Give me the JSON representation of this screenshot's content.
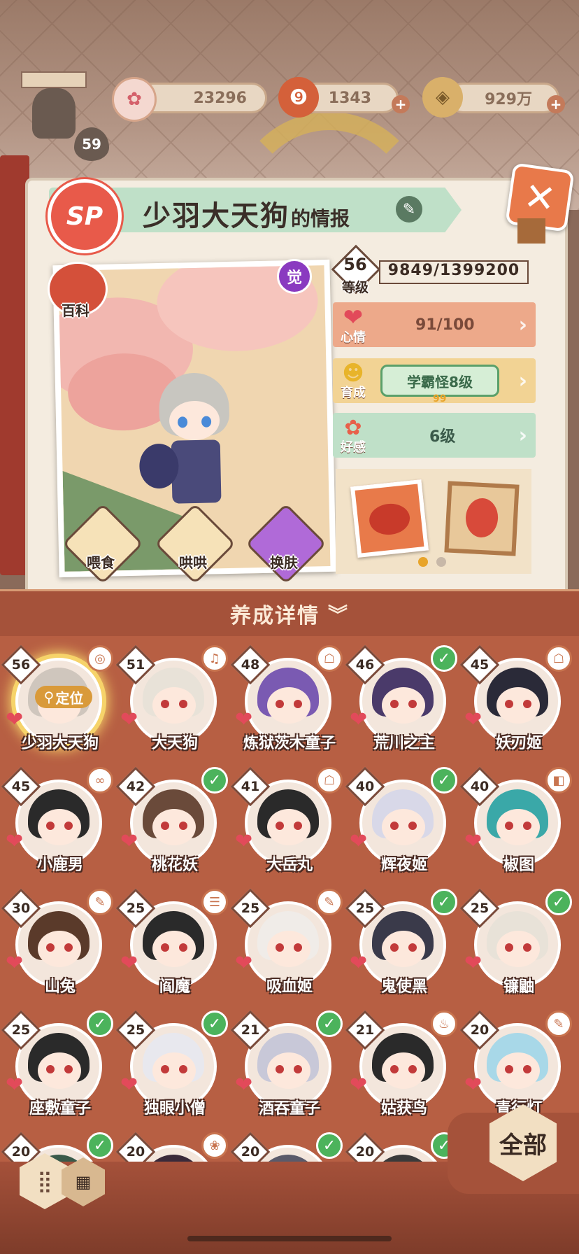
{
  "currency": {
    "player_level": "59",
    "items": [
      {
        "icon": "plum-blossom-icon",
        "value": "23296"
      },
      {
        "icon": "magatama-icon",
        "value": "1343"
      },
      {
        "icon": "coin-icon",
        "value": "929万"
      }
    ]
  },
  "header": {
    "title": "少羽大天狗",
    "title_suffix": "的情报",
    "rarity": "SP",
    "awaken": "觉"
  },
  "portrait": {
    "encyclopedia": "百科",
    "actions": [
      {
        "label": "喂食",
        "icon": "ramen-icon"
      },
      {
        "label": "哄哄",
        "icon": "milk-icon"
      },
      {
        "label": "换肤",
        "icon": "skin-icon"
      }
    ]
  },
  "stats": {
    "level_label": "等级",
    "level": "56",
    "exp": "9849/1399200",
    "mood_label": "心情",
    "mood": "91/100",
    "growth_label": "育成",
    "growth": "学霸怪8级",
    "growth_badge": "99",
    "favor_label": "好感",
    "favor": "6级"
  },
  "roster": {
    "header": "养成详情",
    "locate": "定位",
    "items": [
      {
        "name": "少羽大天狗",
        "level": "56",
        "status": "target",
        "color": "#cfc6bd"
      },
      {
        "name": "大天狗",
        "level": "51",
        "status": "bell",
        "color": "#e8e2d8"
      },
      {
        "name": "炼狱茨木童子",
        "level": "48",
        "status": "scroll",
        "color": "#7a5ab2"
      },
      {
        "name": "荒川之主",
        "level": "46",
        "status": "check",
        "color": "#4a3a6a"
      },
      {
        "name": "妖刀姬",
        "level": "45",
        "status": "scroll",
        "color": "#2a2a38"
      },
      {
        "name": "小鹿男",
        "level": "45",
        "status": "loop",
        "color": "#2a2a2a"
      },
      {
        "name": "桃花妖",
        "level": "42",
        "status": "check",
        "color": "#6a4a3a"
      },
      {
        "name": "大岳丸",
        "level": "41",
        "status": "scroll",
        "color": "#2a2a2a"
      },
      {
        "name": "辉夜姬",
        "level": "40",
        "status": "check",
        "color": "#d8d8e8"
      },
      {
        "name": "椒图",
        "level": "40",
        "status": "bag",
        "color": "#3aa8a8"
      },
      {
        "name": "山兔",
        "level": "30",
        "status": "brush",
        "color": "#5a3a2a"
      },
      {
        "name": "阎魔",
        "level": "25",
        "status": "book",
        "color": "#2a2a2a"
      },
      {
        "name": "吸血姬",
        "level": "25",
        "status": "brush",
        "color": "#f0ece8"
      },
      {
        "name": "鬼使黑",
        "level": "25",
        "status": "check",
        "color": "#3a3a4a"
      },
      {
        "name": "镰鼬",
        "level": "25",
        "status": "check",
        "color": "#e8e2d8"
      },
      {
        "name": "座敷童子",
        "level": "25",
        "status": "check",
        "color": "#2a2a2a"
      },
      {
        "name": "独眼小僧",
        "level": "25",
        "status": "check",
        "color": "#e8e8ee"
      },
      {
        "name": "酒吞童子",
        "level": "21",
        "status": "check",
        "color": "#c8c8d8"
      },
      {
        "name": "姑获鸟",
        "level": "21",
        "status": "chef",
        "color": "#2a2a2a"
      },
      {
        "name": "青行灯",
        "level": "20",
        "status": "brush",
        "color": "#a8d8e8"
      },
      {
        "name": "",
        "level": "20",
        "status": "check",
        "color": "#3a5a4a"
      },
      {
        "name": "",
        "level": "20",
        "status": "shell",
        "color": "#3a2a3a"
      },
      {
        "name": "",
        "level": "20",
        "status": "check",
        "color": "#5a5a6a"
      },
      {
        "name": "",
        "level": "20",
        "status": "check",
        "color": "#3a3a3a"
      }
    ]
  },
  "filter": {
    "label": "全部"
  },
  "colors": {
    "check": "#4cb35c",
    "heart": "#e24a5a",
    "roster_bg": "#b75f43"
  }
}
